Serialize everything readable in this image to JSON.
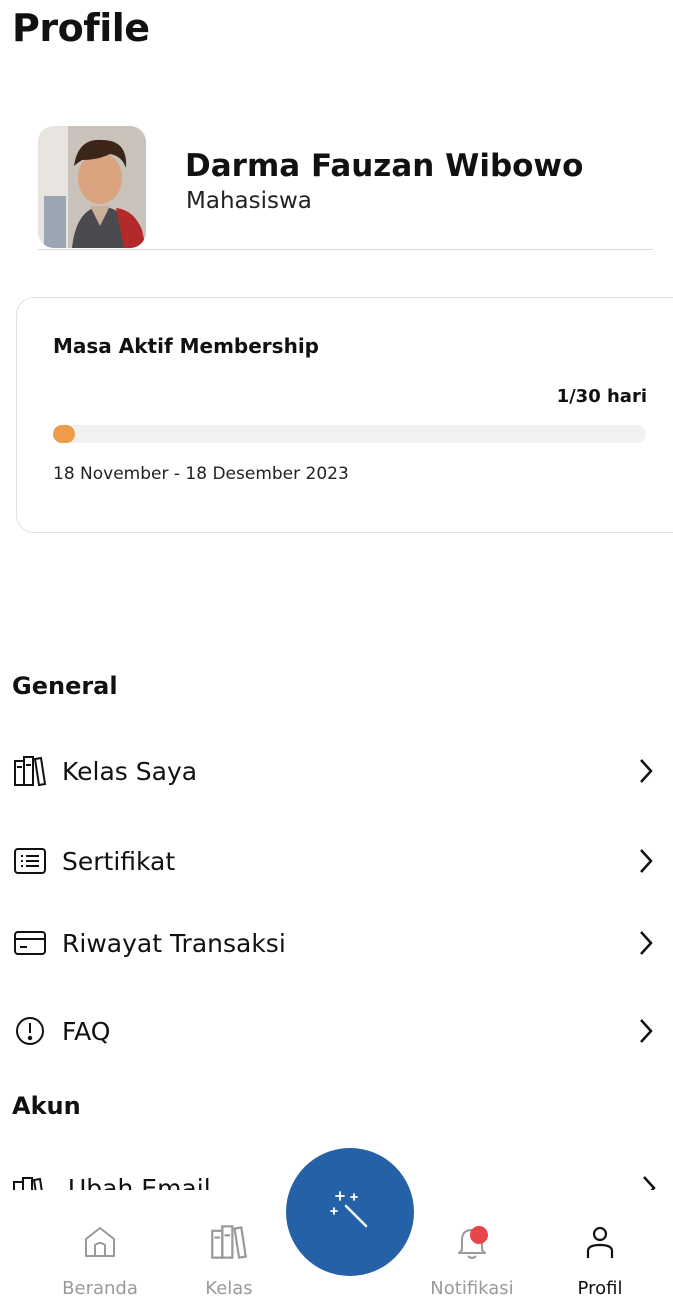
{
  "header": {
    "title": "Profile"
  },
  "profile": {
    "name": "Darma Fauzan Wibowo",
    "role": "Mahasiswa"
  },
  "membership": {
    "title": "Masa Aktif Membership",
    "days_label": "1/30 hari",
    "progress": 0.0333,
    "period": "18 November - 18 Desember 2023",
    "accent_color": "#f09a4b"
  },
  "general": {
    "title": "General",
    "items": [
      {
        "label": "Kelas Saya",
        "icon": "books-icon"
      },
      {
        "label": "Sertifikat",
        "icon": "certificate-icon"
      },
      {
        "label": "Riwayat  Transaksi",
        "icon": "card-icon"
      },
      {
        "label": "FAQ",
        "icon": "info-circle-icon"
      }
    ]
  },
  "account": {
    "title": "Akun",
    "items": [
      {
        "label": "Ubah Email",
        "icon": "books-icon"
      }
    ]
  },
  "nav": {
    "items": [
      {
        "label": "Beranda",
        "icon": "home-icon",
        "active": false
      },
      {
        "label": "Kelas",
        "icon": "books-icon",
        "active": false
      },
      {
        "label": "Notifikasi",
        "icon": "bell-icon",
        "active": false
      },
      {
        "label": "Profil",
        "icon": "user-icon",
        "active": true
      }
    ],
    "fab_icon": "magic-wand-icon",
    "fab_color": "#2461a7"
  }
}
